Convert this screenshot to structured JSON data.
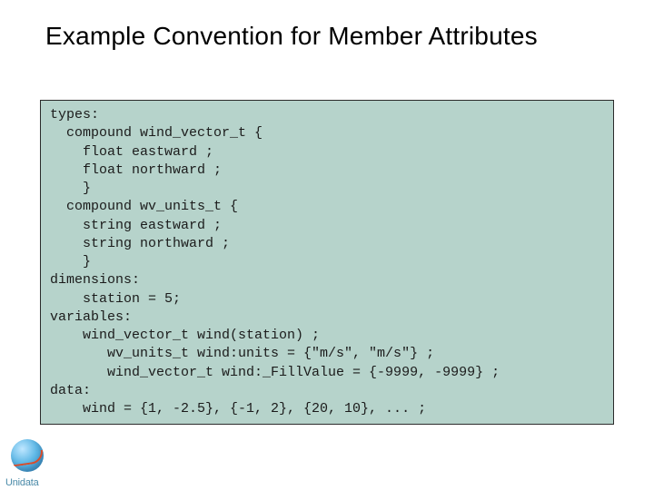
{
  "title": "Example Convention for Member Attributes",
  "code": {
    "l01": "types:",
    "l02": "  compound wind_vector_t {",
    "l03": "    float eastward ;",
    "l04": "    float northward ;",
    "l05": "    }",
    "l06": "  compound wv_units_t {",
    "l07": "    string eastward ;",
    "l08": "    string northward ;",
    "l09": "    }",
    "l10": "dimensions:",
    "l11": "    station = 5;",
    "l12": "variables:",
    "l13": "    wind_vector_t wind(station) ;",
    "l14": "       wv_units_t wind:units = {\"m/s\", \"m/s\"} ;",
    "l15": "       wind_vector_t wind:_FillValue = {-9999, -9999} ;",
    "l16": "data:",
    "l17": "    wind = {1, -2.5}, {-1, 2}, {20, 10}, ... ;"
  },
  "logo": {
    "brand": "Unidata"
  }
}
